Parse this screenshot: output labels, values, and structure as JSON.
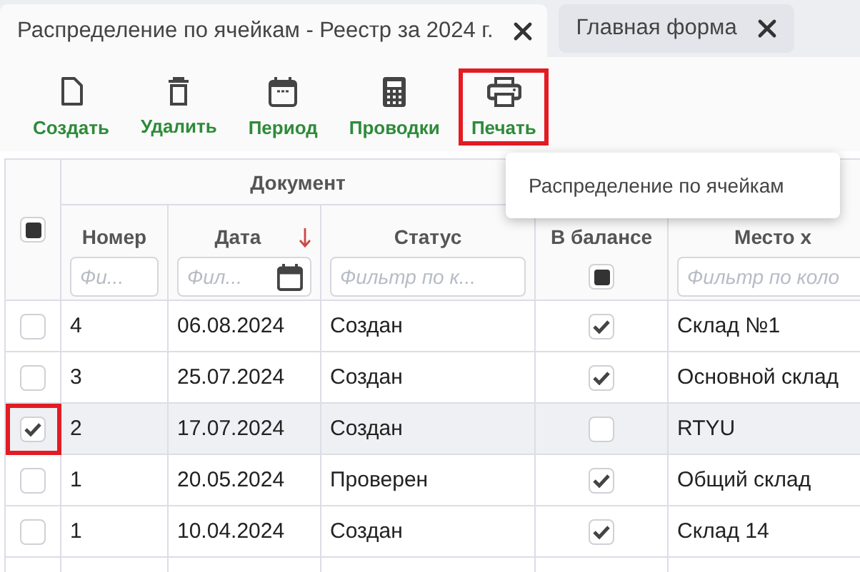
{
  "tabs": [
    {
      "label": "Распределение по ячейкам - Реестр за 2024 г.",
      "selected": true
    },
    {
      "label": "Главная форма",
      "selected": false
    }
  ],
  "toolbar": [
    {
      "label": "Создать",
      "highlighted": false
    },
    {
      "label": "Удалить",
      "highlighted": false
    },
    {
      "label": "Период",
      "highlighted": false
    },
    {
      "label": "Проводки",
      "highlighted": false
    },
    {
      "label": "Печать",
      "highlighted": true
    }
  ],
  "print_menu": {
    "items": [
      "Распределение по ячейкам"
    ]
  },
  "table": {
    "group_header": "Документ",
    "select_all": {
      "partial": true
    },
    "columns": [
      {
        "label": "Номер",
        "sorted_descending": false,
        "filter": {
          "placeholder": "Фи...",
          "calendar": false
        }
      },
      {
        "label": "Дата",
        "sorted_descending": true,
        "filter": {
          "placeholder": "Фил...",
          "calendar": true
        }
      },
      {
        "label": "Статус",
        "sorted_descending": false,
        "filter": {
          "placeholder": "Фильтр по к...",
          "calendar": false
        }
      }
    ],
    "balance_column": {
      "label": "В балансе",
      "filter_partial": true
    },
    "location_column": {
      "label": "Место х",
      "filter": {
        "placeholder": "Фильтр по коло"
      }
    },
    "rows": [
      {
        "selected": false,
        "highlighted": false,
        "cells": [
          "4",
          "06.08.2024",
          "Создан"
        ],
        "in_balance": true,
        "location": "Склад №1"
      },
      {
        "selected": false,
        "highlighted": false,
        "cells": [
          "3",
          "25.07.2024",
          "Создан"
        ],
        "in_balance": true,
        "location": "Основной склад"
      },
      {
        "selected": true,
        "highlighted": true,
        "cells": [
          "2",
          "17.07.2024",
          "Создан"
        ],
        "in_balance": false,
        "location": "RTYU"
      },
      {
        "selected": false,
        "highlighted": false,
        "cells": [
          "1",
          "20.05.2024",
          "Проверен"
        ],
        "in_balance": true,
        "location": "Общий склад"
      },
      {
        "selected": false,
        "highlighted": false,
        "cells": [
          "1",
          "10.04.2024",
          "Создан"
        ],
        "in_balance": true,
        "location": "Склад 14"
      }
    ]
  }
}
